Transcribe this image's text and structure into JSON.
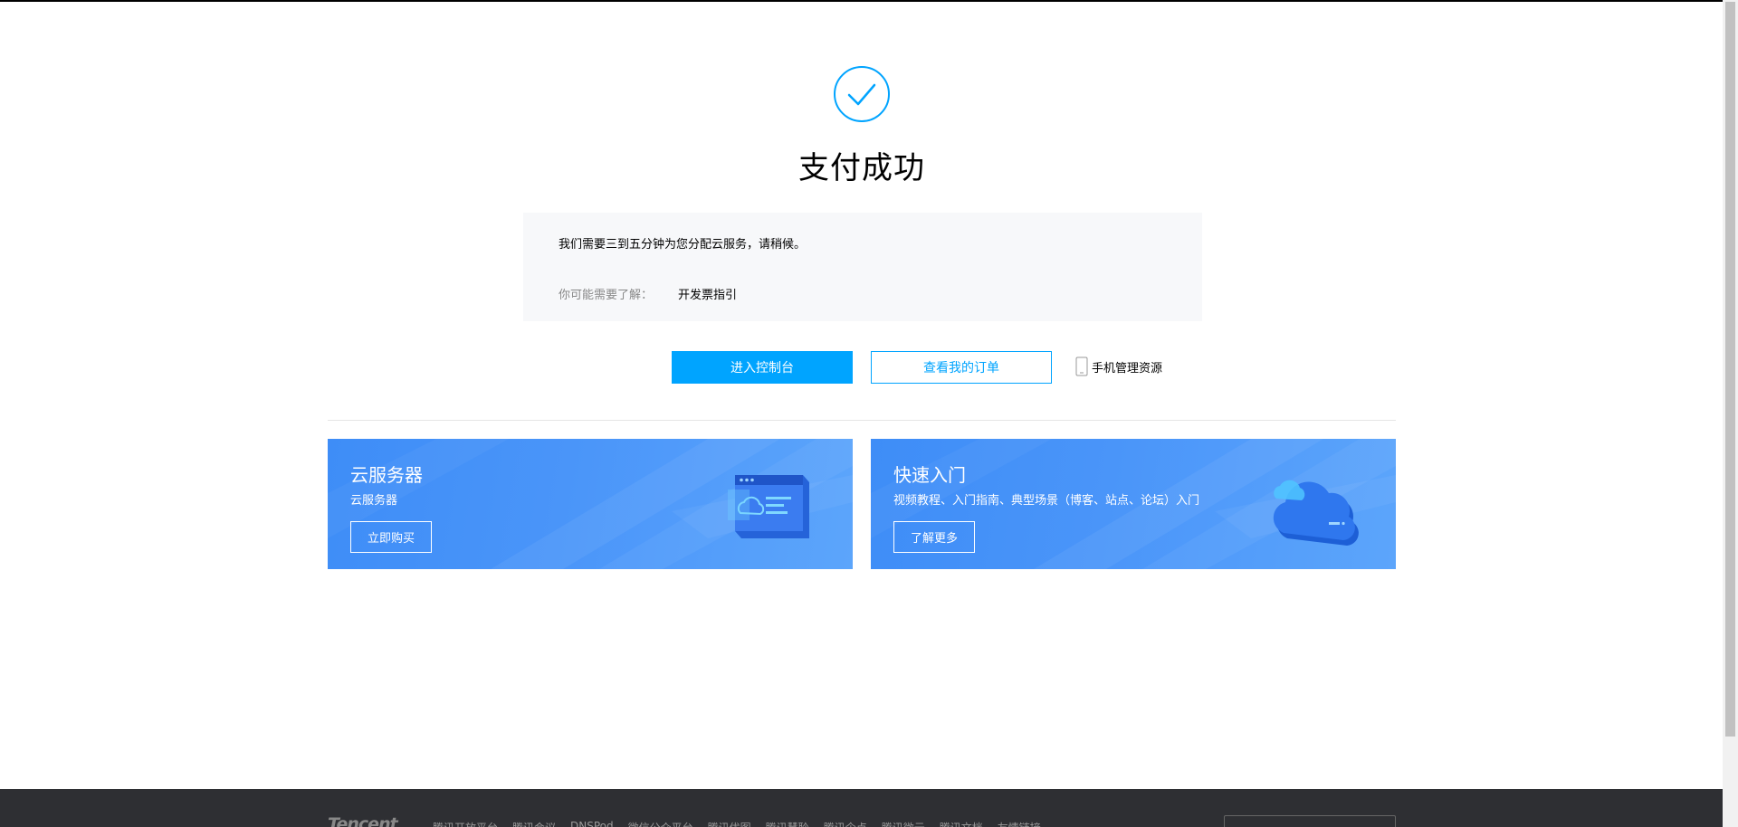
{
  "result": {
    "title": "支付成功",
    "message": "我们需要三到五分钟为您分配云服务，请稍候。",
    "hint_label": "你可能需要了解：",
    "hint_link": "开发票指引"
  },
  "actions": {
    "console_label": "进入控制台",
    "orders_label": "查看我的订单",
    "mobile_label": "手机管理资源"
  },
  "cards": [
    {
      "title": "云服务器",
      "subtitle": "云服务器",
      "button": "立即购买",
      "icon": "server-window-icon"
    },
    {
      "title": "快速入门",
      "subtitle": "视频教程、入门指南、典型场景（博客、站点、论坛）入门",
      "button": "了解更多",
      "icon": "cloud-icon"
    }
  ],
  "footer": {
    "logo": "Tencent",
    "links": [
      "腾讯开放平台",
      "腾讯会议",
      "DNSPod",
      "微信公众平台",
      "腾讯优图",
      "腾讯慧聆",
      "腾讯企点",
      "腾讯微云",
      "腾讯文档",
      "友情链接"
    ]
  },
  "colors": {
    "accent": "#00a4ff",
    "card_blue": "#4a95f9",
    "footer_bg": "#2e2f33"
  }
}
